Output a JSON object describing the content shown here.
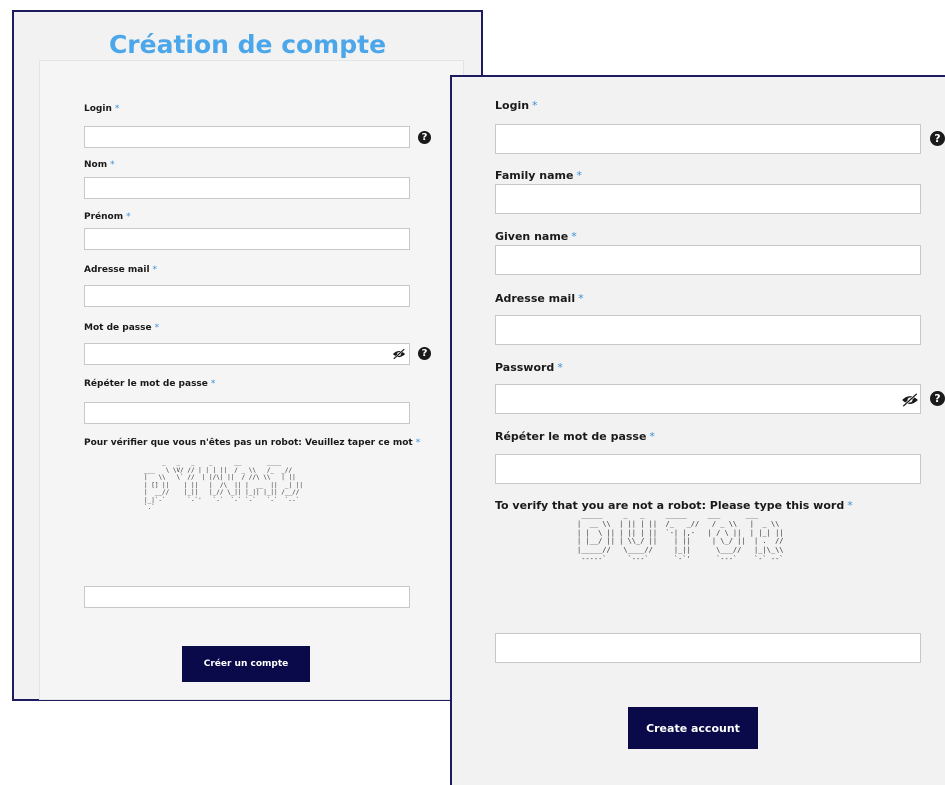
{
  "french_form": {
    "title": "Création de compte",
    "required_mark": "*",
    "login_label": "Login",
    "family_name_label": "Nom",
    "given_name_label": "Prénom",
    "email_label": "Adresse mail",
    "password_label": "Mot de passe",
    "repeat_password_label": "Répéter le mot de passe",
    "captcha_label": "Pour vérifier que vous n'êtes pas un robot: Veuillez taper ce mot",
    "captcha_art": "     _   _   _    _      __       ____\n___   \\ \\V/ // | | | ||  / _ \\\\   /_  _//\n|   \\\\   \\` //  | |/\\| ||  / //\\ \\\\   | ||\n| [] ||    | ||   |  /\\  || |  __  ||  _| ||\n|  __//    |_||   |_// \\_|| |_|| |_|| /__//\n|_|`-`      `-`'   `-`  `-` `-`   `-`  `--`\n`.`",
    "submit_label": "Créer un compte",
    "help_glyph": "?"
  },
  "english_form": {
    "required_mark": "*",
    "login_label": "Login",
    "family_name_label": "Family name",
    "given_name_label": "Given name",
    "email_label": "Adresse mail",
    "password_label": "Password",
    "repeat_password_label": "Répéter le mot de passe",
    "captcha_label": "To verify that you are not a robot: Please type this word",
    "captcha_art": " _____     _   _     _____     ___      ___\n|  __ \\\\  | || | ||  /_   _//   / _ \\\\   |  _ \\\\\n| |  \\ || | || | ||  `-| |,-   | / \\ ||  | |_| ||\n| |__/ || | \\\\_/ ||    | ||     | \\_/ ||  | .  //\n|_____//   \\____//     |_||      \\___//   |_|\\_\\\\\n -----`     `---`      `-`'      `---`    `-` --`",
    "submit_label": "Create account",
    "help_glyph": "?"
  },
  "icons": {
    "help": "question-circle-icon",
    "password_toggle": "eye-slash-icon"
  },
  "colors": {
    "title": "#4ca6ea",
    "button": "#0a0a4a",
    "border": "#1e1b5e",
    "required_asterisk": "#3a8fd8"
  }
}
